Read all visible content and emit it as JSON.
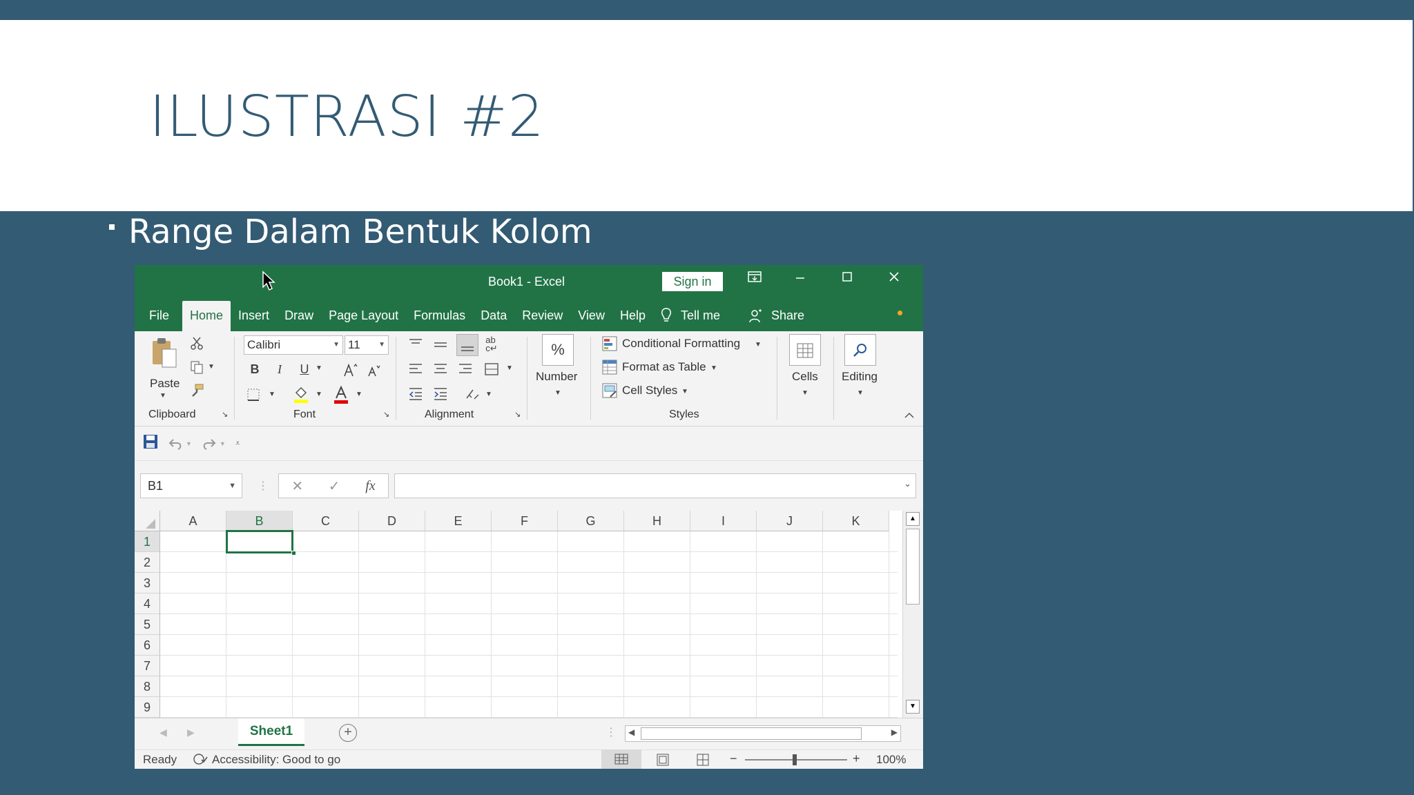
{
  "slide": {
    "title": "ILUSTRASI #2",
    "bullet": "Range Dalam Bentuk Kolom"
  },
  "excel": {
    "window_title": "Book1  -  Excel",
    "sign_in": "Sign in",
    "menu": [
      "File",
      "Home",
      "Insert",
      "Draw",
      "Page Layout",
      "Formulas",
      "Data",
      "Review",
      "View",
      "Help"
    ],
    "tell_me": "Tell me",
    "share": "Share",
    "ribbon": {
      "clipboard": {
        "paste": "Paste",
        "label": "Clipboard"
      },
      "font": {
        "name": "Calibri",
        "size": "11",
        "label": "Font",
        "bold": "B",
        "italic": "I",
        "underline": "U"
      },
      "alignment": {
        "label": "Alignment"
      },
      "number": {
        "symbol": "%",
        "label": "Number"
      },
      "styles": {
        "conditional": "Conditional Formatting",
        "format_table": "Format as Table",
        "cell_styles": "Cell Styles",
        "label": "Styles"
      },
      "cells": {
        "label": "Cells"
      },
      "editing": {
        "label": "Editing"
      }
    },
    "formula_bar": {
      "name_box": "B1",
      "fx": "fx",
      "value": ""
    },
    "columns": [
      "A",
      "B",
      "C",
      "D",
      "E",
      "F",
      "G",
      "H",
      "I",
      "J",
      "K"
    ],
    "selected_column": "B",
    "rows": [
      "1",
      "2",
      "3",
      "4",
      "5",
      "6",
      "7",
      "8",
      "9"
    ],
    "selected_row": "1",
    "sheet_tab": "Sheet1",
    "status": {
      "ready": "Ready",
      "accessibility": "Accessibility: Good to go",
      "zoom": "100%"
    },
    "colors": {
      "brand": "#217346",
      "slide_bg": "#335B74"
    }
  }
}
